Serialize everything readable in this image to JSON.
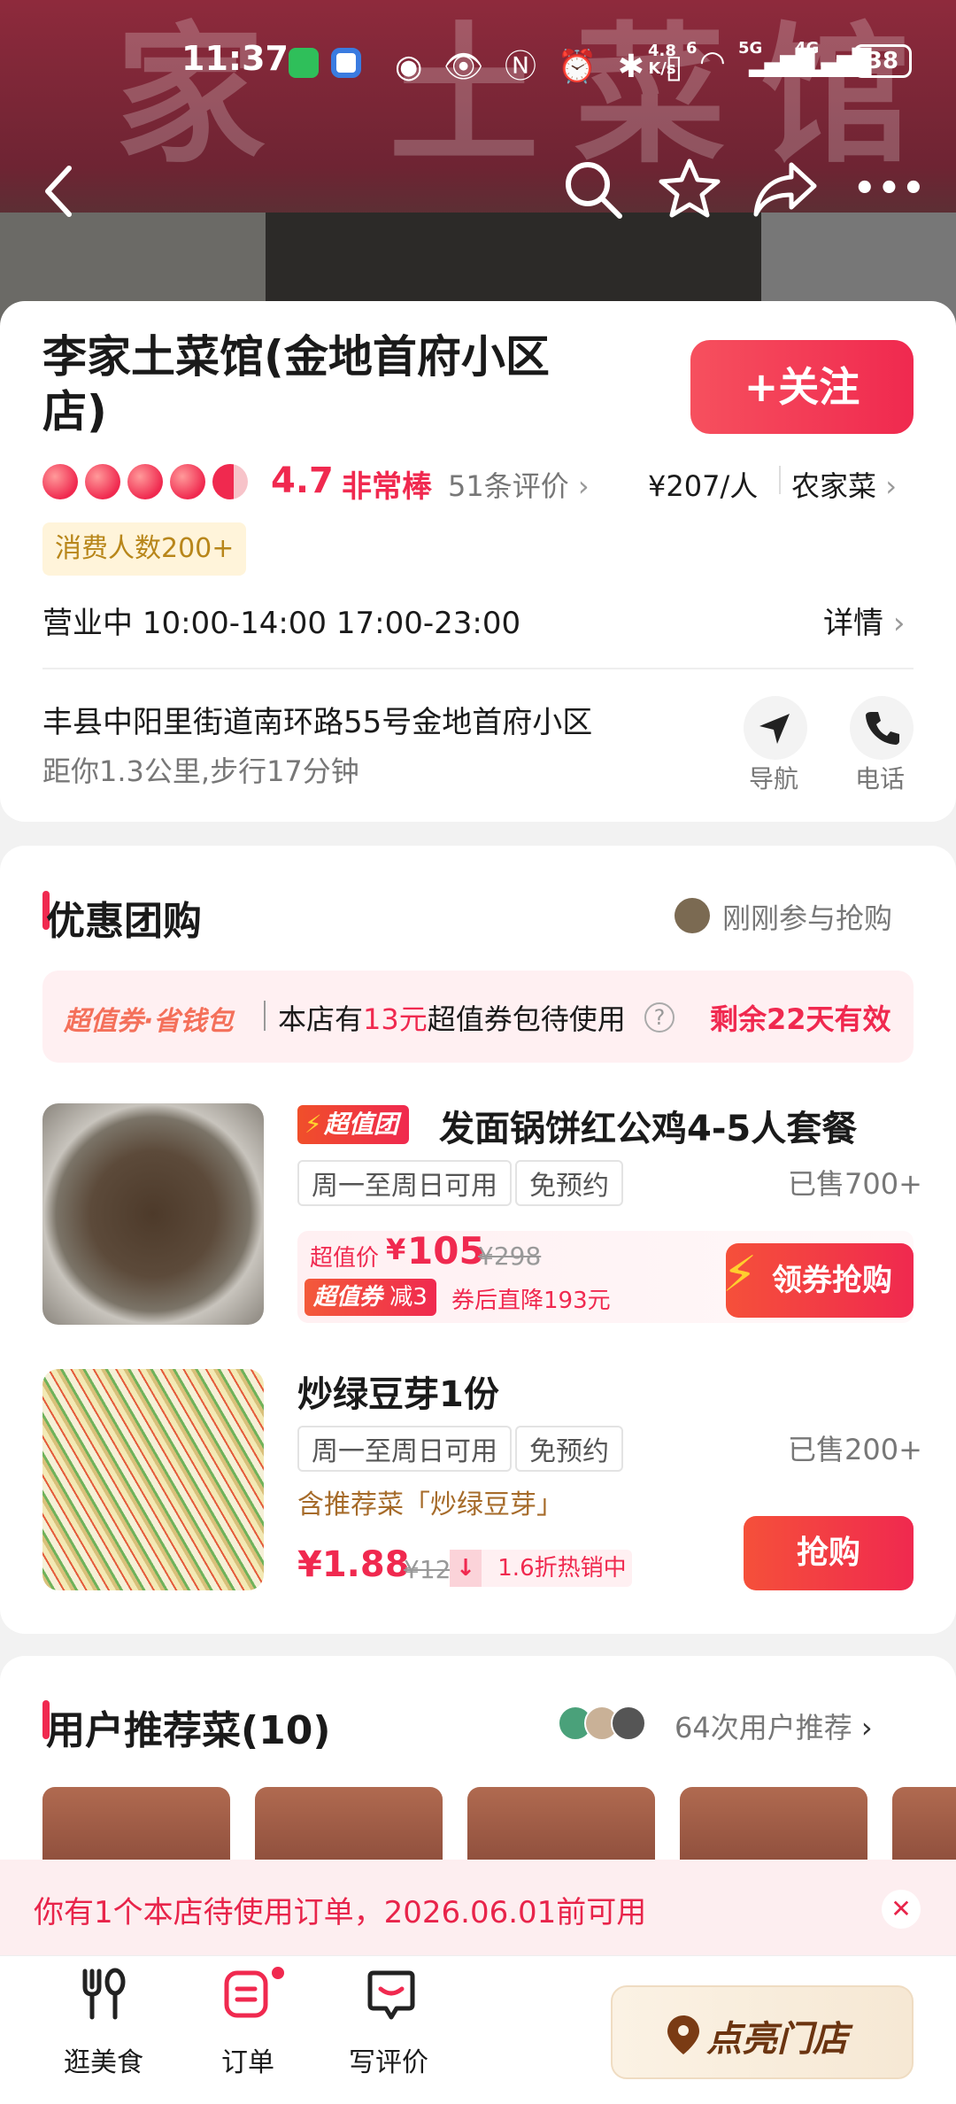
{
  "status_bar": {
    "time": "11:37",
    "speed_top": "4.8",
    "speed_bottom": "K/s",
    "net1": "6",
    "net2": "5G",
    "net3": "4G",
    "battery": "38"
  },
  "hero": {
    "sign_text": "家 土菜馆"
  },
  "store": {
    "name": "李家土菜馆(金地首府小区店)",
    "follow_label": "+关注",
    "rating_hearts": 4.7,
    "rating": "4.7",
    "rating_text": "非常棒",
    "reviews": "51条评价",
    "price": "¥207/人",
    "category": "农家菜",
    "badge": "消费人数200+",
    "status": "营业中",
    "hours": "10:00-14:00 17:00-23:00",
    "details": "详情",
    "address": "丰县中阳里街道南环路55号金地首府小区",
    "distance": "距你1.3公里,步行17分钟",
    "nav_label": "导航",
    "phone_label": "电话"
  },
  "group_buy": {
    "title": "优惠团购",
    "recent": "刚刚参与抢购",
    "coupon_brand": "超值券·省钱包",
    "coupon_pre": "本店有",
    "coupon_amount": "13元",
    "coupon_post": "超值券包待使用",
    "coupon_valid": "剩余22天有效",
    "deals": [
      {
        "badge": "超值团",
        "name": "发面锅饼红公鸡4-5人套餐",
        "tags": [
          "周一至周日可用",
          "免预约"
        ],
        "sold": "已售700+",
        "price_label": "超值价",
        "price_symbol": "¥",
        "price": "105",
        "orig": "¥298",
        "coupon_tag": "超值券",
        "coupon_tag2": "减3",
        "after_coupon": "券后直降193元",
        "button": "领券抢购"
      },
      {
        "name": "炒绿豆芽1份",
        "tags": [
          "周一至周日可用",
          "免预约"
        ],
        "sold": "已售200+",
        "recommend": "含推荐菜「炒绿豆芽」",
        "price": "¥1.88",
        "orig": "¥12",
        "discount": "1.6折热销中",
        "button": "抢购"
      }
    ]
  },
  "recommend": {
    "title": "用户推荐菜(10)",
    "count": "64次用户推荐"
  },
  "banner": {
    "text": "你有1个本店待使用订单，2026.06.01前可用"
  },
  "bottom_nav": {
    "items": [
      {
        "label": "逛美食",
        "icon": "fork-spoon-icon"
      },
      {
        "label": "订单",
        "icon": "order-icon"
      },
      {
        "label": "写评价",
        "icon": "review-icon"
      }
    ],
    "cta": "点亮门店"
  },
  "colors": {
    "accent": "#f0294f",
    "accent_light": "#fff0f2",
    "badge_bg": "#fff4da",
    "badge_fg": "#b8861a"
  }
}
